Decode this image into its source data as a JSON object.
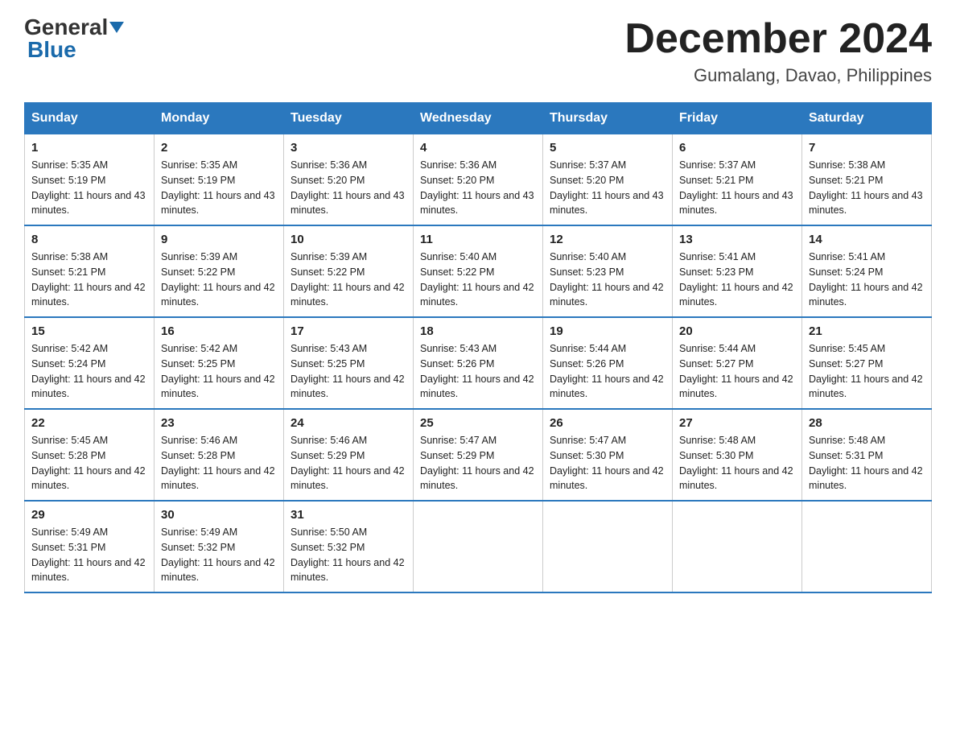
{
  "logo": {
    "general": "General",
    "blue": "Blue",
    "triangle": "▲"
  },
  "title": "December 2024",
  "subtitle": "Gumalang, Davao, Philippines",
  "days_header": [
    "Sunday",
    "Monday",
    "Tuesday",
    "Wednesday",
    "Thursday",
    "Friday",
    "Saturday"
  ],
  "weeks": [
    [
      {
        "day": "1",
        "sunrise": "5:35 AM",
        "sunset": "5:19 PM",
        "daylight": "11 hours and 43 minutes."
      },
      {
        "day": "2",
        "sunrise": "5:35 AM",
        "sunset": "5:19 PM",
        "daylight": "11 hours and 43 minutes."
      },
      {
        "day": "3",
        "sunrise": "5:36 AM",
        "sunset": "5:20 PM",
        "daylight": "11 hours and 43 minutes."
      },
      {
        "day": "4",
        "sunrise": "5:36 AM",
        "sunset": "5:20 PM",
        "daylight": "11 hours and 43 minutes."
      },
      {
        "day": "5",
        "sunrise": "5:37 AM",
        "sunset": "5:20 PM",
        "daylight": "11 hours and 43 minutes."
      },
      {
        "day": "6",
        "sunrise": "5:37 AM",
        "sunset": "5:21 PM",
        "daylight": "11 hours and 43 minutes."
      },
      {
        "day": "7",
        "sunrise": "5:38 AM",
        "sunset": "5:21 PM",
        "daylight": "11 hours and 43 minutes."
      }
    ],
    [
      {
        "day": "8",
        "sunrise": "5:38 AM",
        "sunset": "5:21 PM",
        "daylight": "11 hours and 42 minutes."
      },
      {
        "day": "9",
        "sunrise": "5:39 AM",
        "sunset": "5:22 PM",
        "daylight": "11 hours and 42 minutes."
      },
      {
        "day": "10",
        "sunrise": "5:39 AM",
        "sunset": "5:22 PM",
        "daylight": "11 hours and 42 minutes."
      },
      {
        "day": "11",
        "sunrise": "5:40 AM",
        "sunset": "5:22 PM",
        "daylight": "11 hours and 42 minutes."
      },
      {
        "day": "12",
        "sunrise": "5:40 AM",
        "sunset": "5:23 PM",
        "daylight": "11 hours and 42 minutes."
      },
      {
        "day": "13",
        "sunrise": "5:41 AM",
        "sunset": "5:23 PM",
        "daylight": "11 hours and 42 minutes."
      },
      {
        "day": "14",
        "sunrise": "5:41 AM",
        "sunset": "5:24 PM",
        "daylight": "11 hours and 42 minutes."
      }
    ],
    [
      {
        "day": "15",
        "sunrise": "5:42 AM",
        "sunset": "5:24 PM",
        "daylight": "11 hours and 42 minutes."
      },
      {
        "day": "16",
        "sunrise": "5:42 AM",
        "sunset": "5:25 PM",
        "daylight": "11 hours and 42 minutes."
      },
      {
        "day": "17",
        "sunrise": "5:43 AM",
        "sunset": "5:25 PM",
        "daylight": "11 hours and 42 minutes."
      },
      {
        "day": "18",
        "sunrise": "5:43 AM",
        "sunset": "5:26 PM",
        "daylight": "11 hours and 42 minutes."
      },
      {
        "day": "19",
        "sunrise": "5:44 AM",
        "sunset": "5:26 PM",
        "daylight": "11 hours and 42 minutes."
      },
      {
        "day": "20",
        "sunrise": "5:44 AM",
        "sunset": "5:27 PM",
        "daylight": "11 hours and 42 minutes."
      },
      {
        "day": "21",
        "sunrise": "5:45 AM",
        "sunset": "5:27 PM",
        "daylight": "11 hours and 42 minutes."
      }
    ],
    [
      {
        "day": "22",
        "sunrise": "5:45 AM",
        "sunset": "5:28 PM",
        "daylight": "11 hours and 42 minutes."
      },
      {
        "day": "23",
        "sunrise": "5:46 AM",
        "sunset": "5:28 PM",
        "daylight": "11 hours and 42 minutes."
      },
      {
        "day": "24",
        "sunrise": "5:46 AM",
        "sunset": "5:29 PM",
        "daylight": "11 hours and 42 minutes."
      },
      {
        "day": "25",
        "sunrise": "5:47 AM",
        "sunset": "5:29 PM",
        "daylight": "11 hours and 42 minutes."
      },
      {
        "day": "26",
        "sunrise": "5:47 AM",
        "sunset": "5:30 PM",
        "daylight": "11 hours and 42 minutes."
      },
      {
        "day": "27",
        "sunrise": "5:48 AM",
        "sunset": "5:30 PM",
        "daylight": "11 hours and 42 minutes."
      },
      {
        "day": "28",
        "sunrise": "5:48 AM",
        "sunset": "5:31 PM",
        "daylight": "11 hours and 42 minutes."
      }
    ],
    [
      {
        "day": "29",
        "sunrise": "5:49 AM",
        "sunset": "5:31 PM",
        "daylight": "11 hours and 42 minutes."
      },
      {
        "day": "30",
        "sunrise": "5:49 AM",
        "sunset": "5:32 PM",
        "daylight": "11 hours and 42 minutes."
      },
      {
        "day": "31",
        "sunrise": "5:50 AM",
        "sunset": "5:32 PM",
        "daylight": "11 hours and 42 minutes."
      },
      null,
      null,
      null,
      null
    ]
  ],
  "colors": {
    "header_bg": "#2b78be",
    "header_text": "#ffffff",
    "border": "#2b78be"
  }
}
